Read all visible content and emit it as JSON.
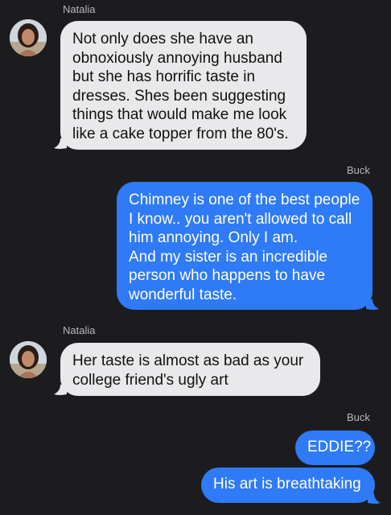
{
  "thread": {
    "messages": [
      {
        "sender": "Natalia",
        "direction": "incoming",
        "text": "Not only does she have an\nobnoxiously annoying husband\nbut she has horrific taste in\ndresses. Shes been suggesting\nthings that would make me look\nlike a cake topper from the 80's."
      },
      {
        "sender": "Buck",
        "direction": "outgoing",
        "text": "Chimney is one of the best people\nI know.. you aren't allowed to call\nhim annoying. Only I am.\nAnd my sister is an incredible\nperson who happens to have\nwonderful taste."
      },
      {
        "sender": "Natalia",
        "direction": "incoming",
        "text": "Her taste is almost as bad as your\ncollege friend's ugly art"
      },
      {
        "sender": "Buck",
        "direction": "outgoing",
        "text": "EDDIE??"
      },
      {
        "sender": "",
        "direction": "outgoing",
        "text": "His art is breathtaking"
      }
    ]
  },
  "colors": {
    "background": "#1c1c1e",
    "incoming_bubble": "#e9e9eb",
    "outgoing_bubble": "#2f7af6",
    "sender_label": "#b8b8bd"
  },
  "icons": {
    "avatar": "contact-photo"
  }
}
